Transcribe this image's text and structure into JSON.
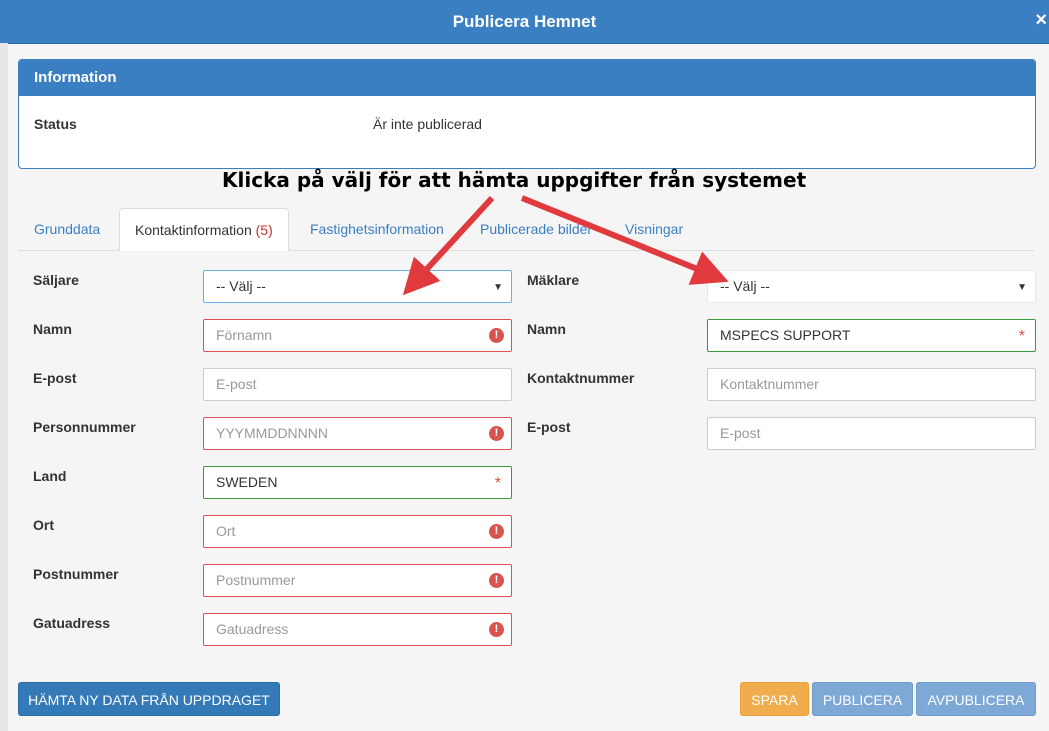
{
  "modal": {
    "title": "Publicera Hemnet",
    "close_label": "×"
  },
  "info_panel": {
    "heading": "Information",
    "status_label": "Status",
    "status_value": "Är inte publicerad"
  },
  "annotation": "Klicka på välj för att hämta uppgifter från systemet",
  "tabs": [
    {
      "label": "Grunddata"
    },
    {
      "label": "Kontaktinformation",
      "count": "(5)"
    },
    {
      "label": "Fastighetsinformation"
    },
    {
      "label": "Publicerade bilder"
    },
    {
      "label": "Visningar"
    }
  ],
  "seller": {
    "saljare_label": "Säljare",
    "saljare_value": "-- Välj --",
    "namn_label": "Namn",
    "namn_placeholder": "Förnamn",
    "epost_label": "E-post",
    "epost_placeholder": "E-post",
    "personnummer_label": "Personnummer",
    "personnummer_placeholder": "YYYMMDDNNNN",
    "land_label": "Land",
    "land_value": "SWEDEN",
    "ort_label": "Ort",
    "ort_placeholder": "Ort",
    "postnummer_label": "Postnummer",
    "postnummer_placeholder": "Postnummer",
    "gatuadress_label": "Gatuadress",
    "gatuadress_placeholder": "Gatuadress"
  },
  "broker": {
    "maklare_label": "Mäklare",
    "maklare_value": "-- Välj --",
    "namn_label": "Namn",
    "namn_value": "MSPECS SUPPORT",
    "kontakt_label": "Kontaktnummer",
    "kontakt_placeholder": "Kontaktnummer",
    "epost_label": "E-post",
    "epost_placeholder": "E-post"
  },
  "footer": {
    "fetch_label": "HÄMTA NY DATA FRÅN UPPDRAGET",
    "save_label": "SPARA",
    "publish_label": "PUBLICERA",
    "unpublish_label": "AVPUBLICERA"
  },
  "colors": {
    "primary": "#3a7fc1",
    "error": "#d9534f",
    "success": "#3c9a3c",
    "warning": "#f0ad4e",
    "annotation_arrow": "#e0393e"
  },
  "icons": {
    "error": "exclamation-circle-icon",
    "required": "asterisk-icon",
    "dropdown": "caret-down-icon",
    "close": "close-icon"
  }
}
